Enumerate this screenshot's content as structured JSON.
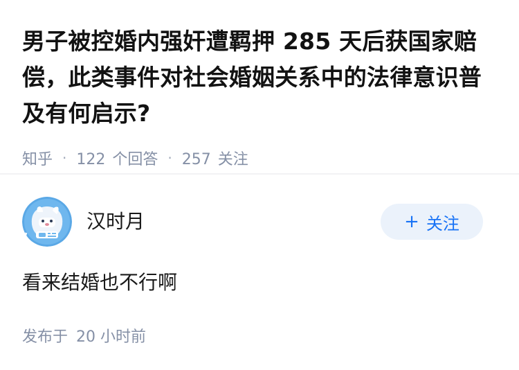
{
  "question": {
    "title": "男子被控婚内强奸遭羁押 285 天后获国家赔偿，此类事件对社会婚姻关系中的法律意识普及有何启示?",
    "meta": {
      "site": "知乎",
      "answer_count": "122",
      "answer_label": "个回答",
      "follow_count": "257",
      "follow_label": "关注"
    }
  },
  "answer": {
    "author": {
      "name": "汉时月",
      "avatar_icon": "cartoon-avatar-icon",
      "follow_button_label": "关注"
    },
    "content": "看来结婚也不行啊",
    "published": {
      "prefix": "发布于",
      "time": "20 小时前"
    }
  },
  "colors": {
    "accent": "#1772f6",
    "button_bg": "#ebf2fb",
    "meta_text": "#8590a6",
    "title_text": "#121212"
  }
}
